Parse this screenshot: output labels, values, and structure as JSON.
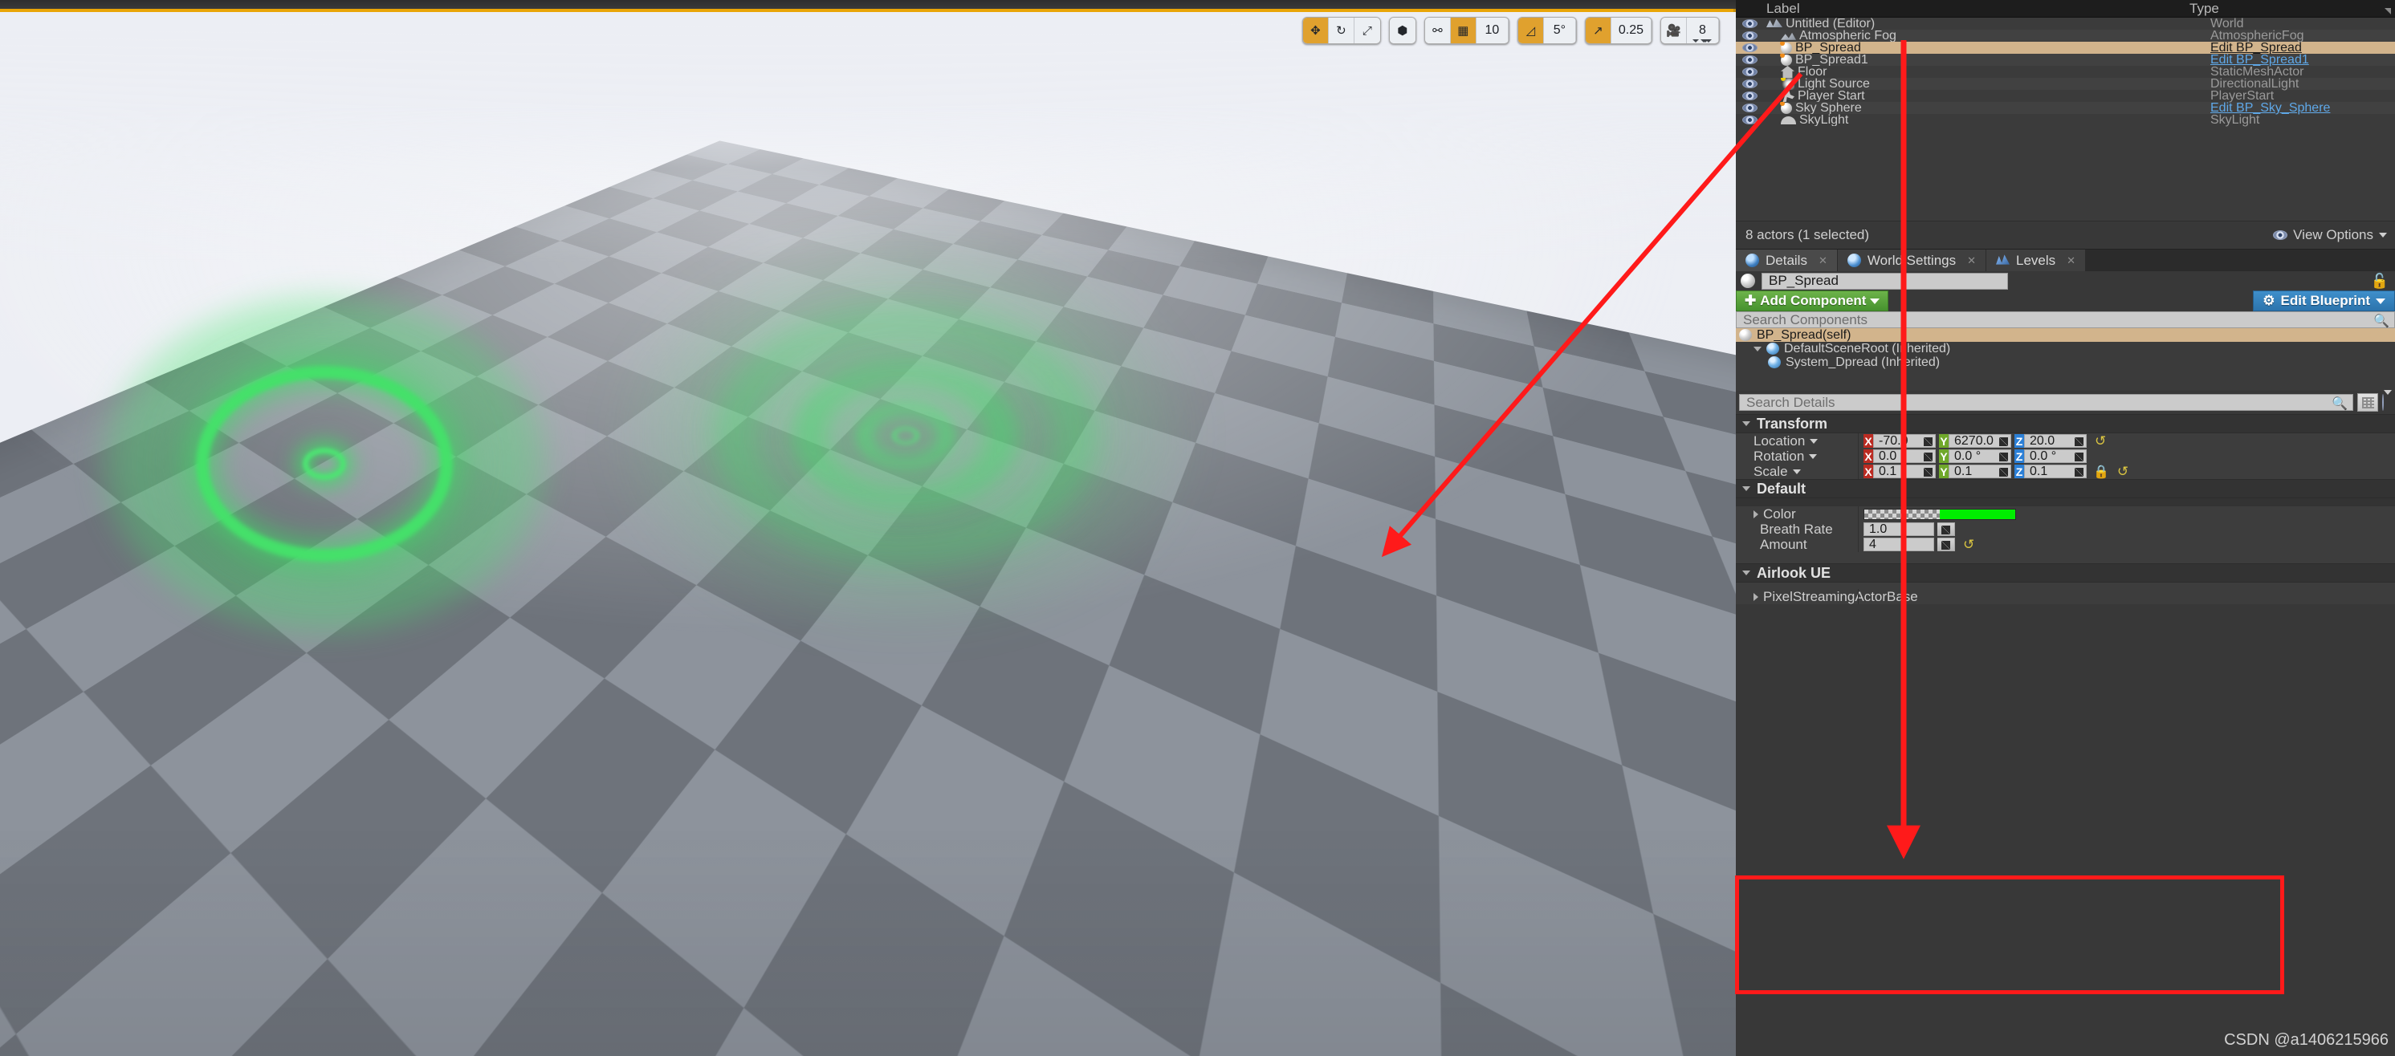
{
  "viewport": {
    "toolbar": {
      "transform_group": [
        {
          "name": "translate-mode-button",
          "glyph": "✥",
          "active": true
        },
        {
          "name": "rotate-mode-button",
          "glyph": "↻",
          "active": false
        },
        {
          "name": "scale-mode-button",
          "glyph": "⤢",
          "active": false
        }
      ],
      "coord_group": [
        {
          "name": "world-coordinate-button",
          "glyph": "◧",
          "active": false
        }
      ],
      "grid_group": [
        {
          "name": "surface-snap-button",
          "glyph": "⚯",
          "active": false
        },
        {
          "name": "grid-snap-button",
          "glyph": "▦",
          "active": true
        }
      ],
      "grid_value": "10",
      "angle_snap_active": true,
      "angle_value": "5°",
      "scale_snap_active": true,
      "scale_value": "0.25",
      "camera_speed_value": "8"
    }
  },
  "outliner": {
    "columns": {
      "label": "Label",
      "type": "Type"
    },
    "rows": [
      {
        "label": "Untitled (Editor)",
        "type": "World",
        "indent": 0,
        "icon": "world-icon",
        "selected": false,
        "link": false
      },
      {
        "label": "Atmospheric Fog",
        "type": "AtmosphericFog",
        "indent": 1,
        "icon": "fog-icon",
        "selected": false,
        "link": false
      },
      {
        "label": "BP_Spread",
        "type": "Edit BP_Spread",
        "indent": 1,
        "icon": "blueprint-icon",
        "selected": true,
        "link": true
      },
      {
        "label": "BP_Spread1",
        "type": "Edit BP_Spread1",
        "indent": 1,
        "icon": "blueprint-icon",
        "selected": false,
        "link": true
      },
      {
        "label": "Floor",
        "type": "StaticMeshActor",
        "indent": 1,
        "icon": "mesh-icon",
        "selected": false,
        "link": false
      },
      {
        "label": "Light Source",
        "type": "DirectionalLight",
        "indent": 1,
        "icon": "light-icon",
        "selected": false,
        "link": false
      },
      {
        "label": "Player Start",
        "type": "PlayerStart",
        "indent": 1,
        "icon": "player-icon",
        "selected": false,
        "link": false
      },
      {
        "label": "Sky Sphere",
        "type": "Edit BP_Sky_Sphere",
        "indent": 1,
        "icon": "sphere-icon",
        "selected": false,
        "link": true
      },
      {
        "label": "SkyLight",
        "type": "SkyLight",
        "indent": 1,
        "icon": "skylight-icon",
        "selected": false,
        "link": false
      }
    ],
    "status": "8 actors (1 selected)",
    "view_options": "View Options"
  },
  "details": {
    "tabs": [
      {
        "label": "Details",
        "active": true
      },
      {
        "label": "World Settings",
        "active": false
      },
      {
        "label": "Levels",
        "active": false
      }
    ],
    "actor_name": "BP_Spread",
    "add_component_label": "Add Component",
    "edit_blueprint_label": "Edit Blueprint",
    "search_components_placeholder": "Search Components",
    "component_tree": [
      {
        "label": "BP_Spread(self)",
        "indent": 0,
        "selected": true,
        "expander": "none"
      },
      {
        "label": "DefaultSceneRoot (Inherited)",
        "indent": 1,
        "selected": false,
        "expander": "down"
      },
      {
        "label": "System_Dpread (Inherited)",
        "indent": 2,
        "selected": false,
        "expander": "none"
      }
    ],
    "search_details_placeholder": "Search Details",
    "transform": {
      "title": "Transform",
      "rows": [
        {
          "label": "Location",
          "x": "-70.0",
          "y": "6270.0",
          "z": "20.0",
          "reset": true,
          "lock": false
        },
        {
          "label": "Rotation",
          "x": "0.0 °",
          "y": "0.0 °",
          "z": "0.0 °",
          "reset": false,
          "lock": false
        },
        {
          "label": "Scale",
          "x": "0.1",
          "y": "0.1",
          "z": "0.1",
          "reset": true,
          "lock": true
        }
      ]
    },
    "default_section": {
      "title": "Default",
      "color_label": "Color",
      "color_value": "#00ee00",
      "breath_rate_label": "Breath Rate",
      "breath_rate_value": "1.0",
      "amount_label": "Amount",
      "amount_value": "4"
    },
    "airlook_section": {
      "title": "Airlook UE",
      "rows": [
        {
          "label": "PixelStreamingActorBase"
        }
      ]
    }
  },
  "watermark": "CSDN @a1406215966"
}
